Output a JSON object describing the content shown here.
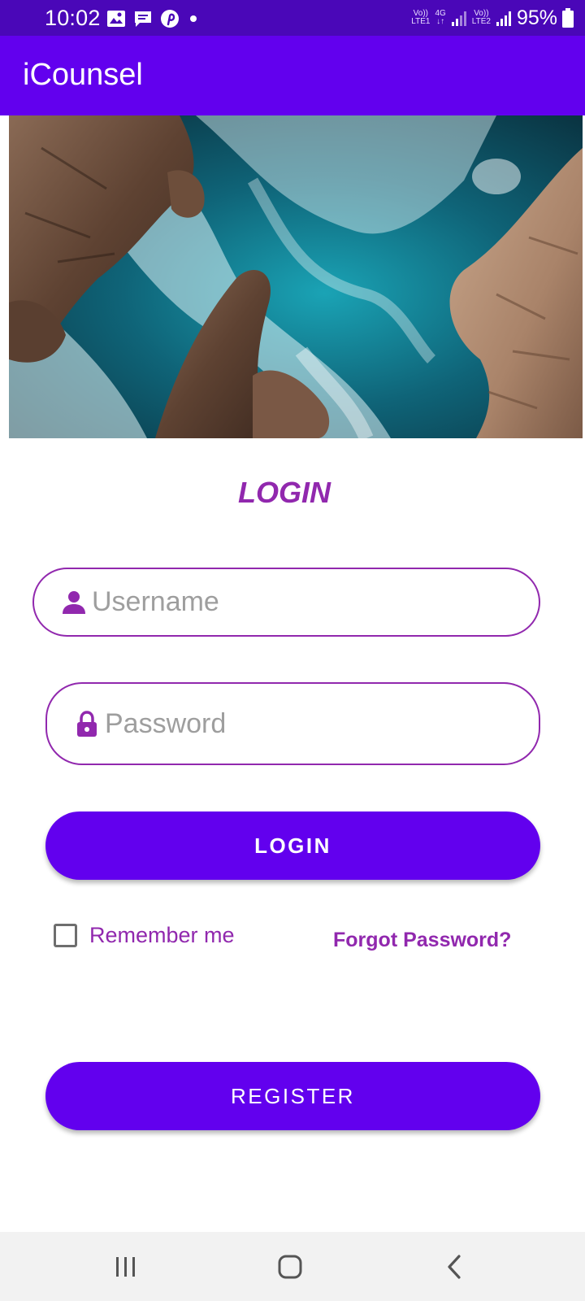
{
  "status_bar": {
    "time": "10:02",
    "icons": [
      "gallery-icon",
      "message-icon",
      "pinterest-icon",
      "dot-icon"
    ],
    "network": [
      {
        "top": "Vo))",
        "bottom": "LTE1"
      },
      {
        "top": "4G",
        "bottom": "↓↑"
      },
      {
        "top": "Vo))",
        "bottom": "LTE2"
      }
    ],
    "battery": "95%"
  },
  "app_bar": {
    "title": "iCounsel",
    "color": "#6200ee"
  },
  "hero_image": {
    "subject": "aerial-coastline-rocks-waves"
  },
  "login_form": {
    "title": "LOGIN",
    "username": {
      "placeholder": "Username",
      "value": "",
      "icon": "person-icon"
    },
    "password": {
      "placeholder": "Password",
      "value": "",
      "icon": "lock-icon"
    },
    "login_button": "LOGIN",
    "remember_me": {
      "label": "Remember me",
      "checked": false
    },
    "forgot_password": "Forgot Password?",
    "register_button": "REGISTER",
    "accent_color": "#9128ae"
  },
  "nav_bar": {
    "buttons": [
      "recents-icon",
      "home-icon",
      "back-icon"
    ]
  }
}
